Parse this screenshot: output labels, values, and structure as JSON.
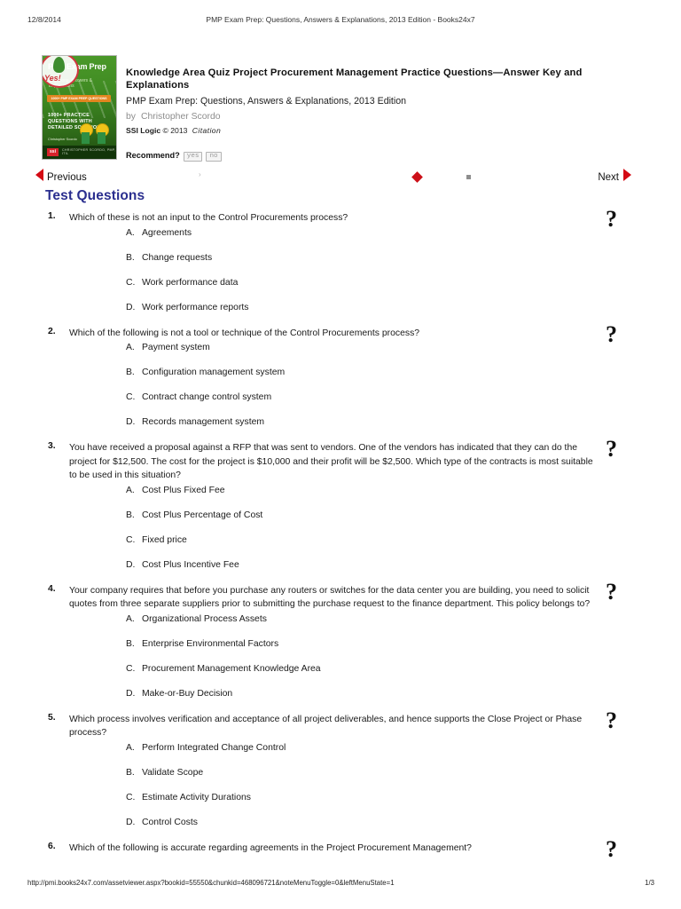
{
  "print_header": {
    "date": "12/8/2014",
    "title": "PMP Exam Prep: Questions, Answers & Explanations, 2013 Edition - Books24x7"
  },
  "book": {
    "cover": {
      "title": "PMP Exam Prep",
      "subtitle": "Questions, Answers & Explanations",
      "band": "1000+ PMP EXAM PREP QUESTIONS",
      "feature_line": "1000+ PRACTICE QUESTIONS WITH DETAILED SOLUTIONS",
      "author_line": "Christopher Scordo",
      "logo": "ssi",
      "footer_text": "CHRISTOPHER SCORDO, PMP, ITIL",
      "stamp_text": "Yes!"
    },
    "heading": "Knowledge Area Quiz Project Procurement Management Practice Questions—Answer Key and Explanations",
    "subtitle": "PMP Exam Prep: Questions, Answers & Explanations, 2013 Edition",
    "by_label": "by",
    "author": "Christopher Scordo",
    "publisher": "SSI Logic",
    "copyright_symbol": "©",
    "year": "2013",
    "citation_label": "Citation",
    "recommend_label": "Recommend?",
    "recommend_yes": "yes",
    "recommend_no": "no"
  },
  "nav": {
    "previous_label": "Previous",
    "next_label": "Next",
    "caret": "›",
    "accent_color": "#d40a14",
    "diamond_color": "#cc1018",
    "square_color": "#8e8e8e"
  },
  "section": {
    "title": "Test Questions",
    "title_color": "#2b2f8f",
    "help_glyph": "?"
  },
  "questions": [
    {
      "number": "1.",
      "text": "Which of these is not an input to the Control Procurements process?",
      "options": [
        {
          "letter": "A.",
          "text": "Agreements"
        },
        {
          "letter": "B.",
          "text": "Change requests"
        },
        {
          "letter": "C.",
          "text": "Work performance data"
        },
        {
          "letter": "D.",
          "text": "Work performance reports"
        }
      ]
    },
    {
      "number": "2.",
      "text": "Which of the following is not a tool or technique of the Control Procurements process?",
      "options": [
        {
          "letter": "A.",
          "text": "Payment system"
        },
        {
          "letter": "B.",
          "text": "Configuration management system"
        },
        {
          "letter": "C.",
          "text": "Contract change control system"
        },
        {
          "letter": "D.",
          "text": "Records management system"
        }
      ]
    },
    {
      "number": "3.",
      "text": "You have received a proposal against a RFP that was sent to vendors. One of the vendors has indicated that they can do the project for $12,500. The cost for the project is $10,000 and their profit will be $2,500. Which type of the contracts is most suitable to be used in this situation?",
      "options": [
        {
          "letter": "A.",
          "text": "Cost Plus Fixed Fee"
        },
        {
          "letter": "B.",
          "text": "Cost Plus Percentage of Cost"
        },
        {
          "letter": "C.",
          "text": "Fixed price"
        },
        {
          "letter": "D.",
          "text": "Cost Plus Incentive Fee"
        }
      ]
    },
    {
      "number": "4.",
      "text": "Your company requires that before you purchase any routers or switches for the data center you are building, you need to solicit quotes from three separate suppliers prior to submitting the purchase request to the finance department. This policy belongs to?",
      "options": [
        {
          "letter": "A.",
          "text": "Organizational Process Assets"
        },
        {
          "letter": "B.",
          "text": "Enterprise Environmental Factors"
        },
        {
          "letter": "C.",
          "text": "Procurement Management Knowledge Area"
        },
        {
          "letter": "D.",
          "text": "Make-or-Buy Decision"
        }
      ]
    },
    {
      "number": "5.",
      "text": "Which process involves verification and acceptance of all project deliverables, and hence supports the Close Project or Phase process?",
      "options": [
        {
          "letter": "A.",
          "text": "Perform Integrated Change Control"
        },
        {
          "letter": "B.",
          "text": "Validate Scope"
        },
        {
          "letter": "C.",
          "text": "Estimate Activity Durations"
        },
        {
          "letter": "D.",
          "text": "Control Costs"
        }
      ]
    },
    {
      "number": "6.",
      "text": "Which of the following is accurate regarding agreements in the Project Procurement Management?",
      "options": []
    }
  ],
  "print_footer": {
    "url": "http://pmi.books24x7.com/assetviewer.aspx?bookid=55550&chunkid=468096721&noteMenuToggle=0&leftMenuState=1",
    "page": "1/3"
  }
}
